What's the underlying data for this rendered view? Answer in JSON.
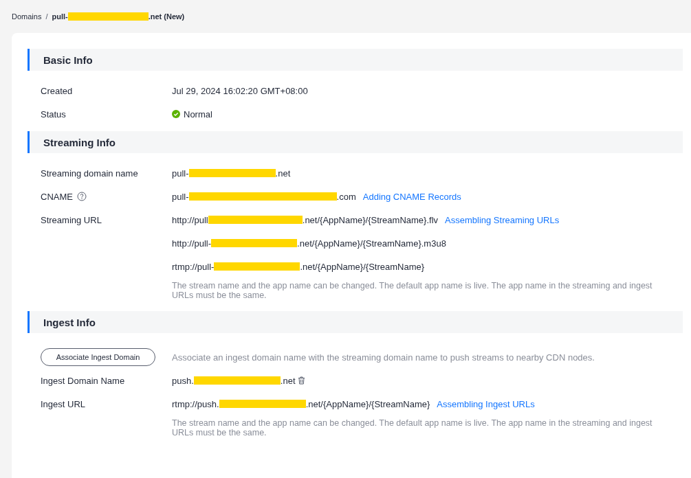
{
  "breadcrumb": {
    "parent": "Domains",
    "separator": "/",
    "current": {
      "before": "pull-",
      "after": ".net (New)",
      "redacted": true
    }
  },
  "sections": [
    {
      "title": "Basic Info",
      "rows": [
        {
          "kind": "text",
          "label": "Created",
          "lines": [
            {
              "before": "Jul 29, 2024 16:02:20 GMT+08:00"
            }
          ]
        },
        {
          "kind": "status",
          "label": "Status",
          "ok": true,
          "value": "Normal"
        }
      ]
    },
    {
      "title": "Streaming Info",
      "rows": [
        {
          "kind": "text",
          "label": "Streaming domain name",
          "lines": [
            {
              "before": "pull-",
              "after": ".net",
              "redacted": true
            }
          ]
        },
        {
          "kind": "text",
          "label": "CNAME",
          "help": true,
          "lines": [
            {
              "before": "pull-",
              "after": ".com",
              "redacted": true,
              "link": "Adding CNAME Records"
            }
          ]
        },
        {
          "kind": "text",
          "label": "Streaming URL",
          "lines": [
            {
              "before": "http://pull",
              "after": ".net/{AppName}/{StreamName}.flv",
              "redacted": true,
              "link": "Assembling Streaming URLs"
            },
            {
              "before": "http://pull-",
              "after": ".net/{AppName}/{StreamName}.m3u8",
              "redacted": true
            },
            {
              "before": "rtmp://pull-",
              "after": ".net/{AppName}/{StreamName}",
              "redacted": true
            }
          ],
          "note": "The stream name and the app name can be changed. The default app name is live. The app name in the streaming and ingest URLs must be the same."
        }
      ]
    },
    {
      "title": "Ingest Info",
      "rows": [
        {
          "kind": "action",
          "button": "Associate Ingest Domain",
          "description": "Associate an ingest domain name with the streaming domain name to push streams to nearby CDN nodes."
        },
        {
          "kind": "text",
          "label": "Ingest Domain Name",
          "lines": [
            {
              "before": "push.",
              "after": ".net",
              "redacted": true,
              "delete": true
            }
          ]
        },
        {
          "kind": "text",
          "label": "Ingest URL",
          "lines": [
            {
              "before": "rtmp://push.",
              "after": ".net/{AppName}/{StreamName}",
              "redacted": true,
              "link": "Assembling Ingest URLs"
            }
          ],
          "note": "The stream name and the app name can be changed. The default app name is live. The app name in the streaming and ingest URLs must be the same."
        }
      ]
    }
  ]
}
